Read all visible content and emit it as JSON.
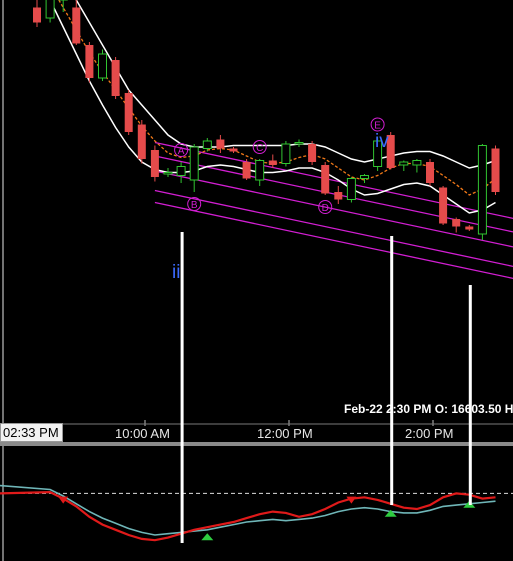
{
  "chart_data": {
    "type": "candlestick",
    "time_axis": {
      "ticks": [
        "10:00 AM",
        "12:00 PM",
        "2:00 PM"
      ]
    },
    "cursor_time": "02:33 PM",
    "header": "Feb-22 2:30 PM  O: 16603.50  H",
    "wave_labels": [
      "iii",
      "iv"
    ],
    "point_labels": [
      "A",
      "B",
      "C",
      "D",
      "E"
    ],
    "ylim": [
      16560,
      16760
    ],
    "candles": [
      {
        "o": 16755,
        "h": 16765,
        "l": 16742,
        "c": 16745
      },
      {
        "o": 16748,
        "h": 16765,
        "l": 16745,
        "c": 16762
      },
      {
        "o": 16760,
        "h": 16768,
        "l": 16752,
        "c": 16766
      },
      {
        "o": 16755,
        "h": 16760,
        "l": 16730,
        "c": 16731
      },
      {
        "o": 16730,
        "h": 16732,
        "l": 16705,
        "c": 16708
      },
      {
        "o": 16708,
        "h": 16727,
        "l": 16706,
        "c": 16724
      },
      {
        "o": 16720,
        "h": 16722,
        "l": 16694,
        "c": 16696
      },
      {
        "o": 16698,
        "h": 16700,
        "l": 16670,
        "c": 16672
      },
      {
        "o": 16677,
        "h": 16680,
        "l": 16651,
        "c": 16654
      },
      {
        "o": 16660,
        "h": 16663,
        "l": 16639,
        "c": 16642
      },
      {
        "o": 16645,
        "h": 16648,
        "l": 16642,
        "c": 16645
      },
      {
        "o": 16643,
        "h": 16652,
        "l": 16638,
        "c": 16649
      },
      {
        "o": 16640,
        "h": 16664,
        "l": 16632,
        "c": 16662
      },
      {
        "o": 16661,
        "h": 16668,
        "l": 16659,
        "c": 16666
      },
      {
        "o": 16667,
        "h": 16670,
        "l": 16658,
        "c": 16661
      },
      {
        "o": 16661,
        "h": 16662,
        "l": 16658,
        "c": 16659
      },
      {
        "o": 16652,
        "h": 16654,
        "l": 16640,
        "c": 16641
      },
      {
        "o": 16640,
        "h": 16654,
        "l": 16636,
        "c": 16653
      },
      {
        "o": 16653,
        "h": 16657,
        "l": 16648,
        "c": 16650
      },
      {
        "o": 16651,
        "h": 16666,
        "l": 16649,
        "c": 16664
      },
      {
        "o": 16664,
        "h": 16667,
        "l": 16662,
        "c": 16665
      },
      {
        "o": 16664,
        "h": 16666,
        "l": 16650,
        "c": 16652
      },
      {
        "o": 16650,
        "h": 16652,
        "l": 16630,
        "c": 16631
      },
      {
        "o": 16632,
        "h": 16636,
        "l": 16624,
        "c": 16627
      },
      {
        "o": 16627,
        "h": 16642,
        "l": 16625,
        "c": 16641
      },
      {
        "o": 16641,
        "h": 16644,
        "l": 16638,
        "c": 16643
      },
      {
        "o": 16649,
        "h": 16669,
        "l": 16646,
        "c": 16666
      },
      {
        "o": 16670,
        "h": 16672,
        "l": 16647,
        "c": 16648
      },
      {
        "o": 16650,
        "h": 16653,
        "l": 16646,
        "c": 16652
      },
      {
        "o": 16650,
        "h": 16654,
        "l": 16645,
        "c": 16653
      },
      {
        "o": 16652,
        "h": 16654,
        "l": 16636,
        "c": 16638
      },
      {
        "o": 16635,
        "h": 16636,
        "l": 16610,
        "c": 16611
      },
      {
        "o": 16614,
        "h": 16615,
        "l": 16605,
        "c": 16609
      },
      {
        "o": 16609,
        "h": 16610,
        "l": 16606,
        "c": 16607
      },
      {
        "o": 16604,
        "h": 16664,
        "l": 16600,
        "c": 16663
      },
      {
        "o": 16661,
        "h": 16663,
        "l": 16630,
        "c": 16632
      }
    ],
    "ema_fast": [
      16790,
      16770,
      16755,
      16740,
      16725,
      16712,
      16700,
      16688,
      16676,
      16666,
      16658,
      16655,
      16656,
      16660,
      16661,
      16660,
      16656,
      16652,
      16651,
      16652,
      16655,
      16657,
      16654,
      16648,
      16642,
      16640,
      16643,
      16648,
      16651,
      16651,
      16649,
      16643,
      16637,
      16630,
      16634,
      16641
    ],
    "avg_upper": [
      16805,
      16790,
      16775,
      16760,
      16745,
      16730,
      16715,
      16700,
      16690,
      16680,
      16670,
      16664,
      16662,
      16662,
      16662,
      16663,
      16663,
      16663,
      16663,
      16663,
      16664,
      16664,
      16662,
      16658,
      16654,
      16652,
      16654,
      16656,
      16658,
      16659,
      16659,
      16656,
      16652,
      16648,
      16650,
      16653
    ],
    "avg_lower": [
      16780,
      16760,
      16742,
      16724,
      16706,
      16690,
      16675,
      16662,
      16652,
      16647,
      16645,
      16645,
      16646,
      16649,
      16650,
      16649,
      16647,
      16645,
      16645,
      16646,
      16648,
      16648,
      16645,
      16640,
      16634,
      16630,
      16631,
      16634,
      16637,
      16638,
      16636,
      16630,
      16624,
      16618,
      16620,
      16625
    ],
    "channel": {
      "slope_per_bar": -1.85,
      "lines": [
        {
          "x0": 9,
          "y0": 16665
        },
        {
          "x0": 9,
          "y0": 16656
        },
        {
          "x0": 9,
          "y0": 16646
        },
        {
          "x0": 9,
          "y0": 16633
        },
        {
          "x0": 9,
          "y0": 16625
        }
      ]
    },
    "osc": {
      "red": [
        52,
        53,
        48,
        42,
        34,
        28,
        24,
        20,
        17,
        16,
        18,
        21,
        24,
        26,
        28,
        30,
        33,
        36,
        38,
        37,
        34,
        36,
        40,
        45,
        48,
        49,
        47,
        44,
        41,
        40,
        43,
        49,
        52,
        51,
        48,
        49
      ],
      "teal": [
        58,
        55,
        50,
        44,
        38,
        33,
        29,
        25,
        22,
        20,
        21,
        22,
        23,
        24,
        26,
        28,
        30,
        31,
        32,
        31,
        32,
        33,
        35,
        38,
        40,
        41,
        40,
        38,
        37,
        37,
        39,
        42,
        43,
        44,
        45,
        46
      ],
      "level": 52
    },
    "verticals": [
      11,
      27,
      33
    ]
  }
}
